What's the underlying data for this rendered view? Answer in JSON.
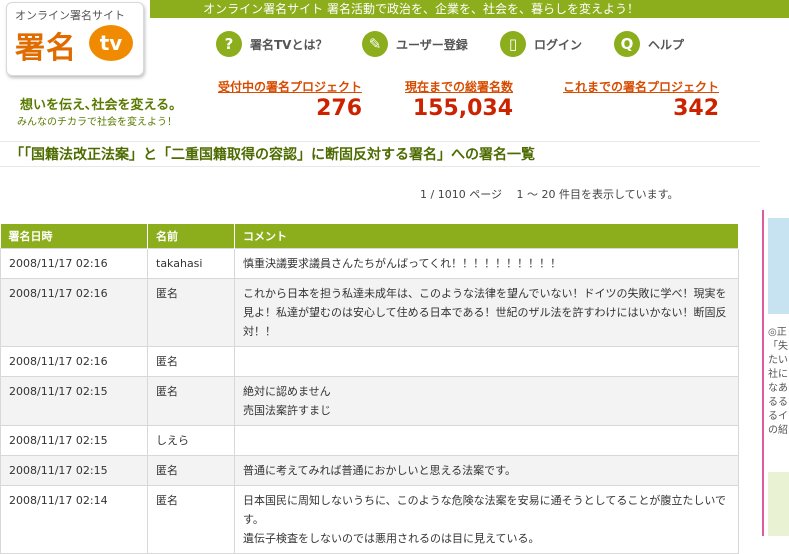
{
  "header": {
    "banner": "オンライン署名サイト 署名活動で政治を、企業を、社会を、暮らしを変えよう！",
    "logo_sub": "オンライン署名サイト",
    "logo_main": "署名",
    "logo_tv": "tv"
  },
  "nav": [
    {
      "icon": "question-icon",
      "glyph": "?",
      "label": "署名TVとは？"
    },
    {
      "icon": "pencil-icon",
      "glyph": "✎",
      "label": "ユーザー登録"
    },
    {
      "icon": "login-icon",
      "glyph": "▯",
      "label": "ログイン"
    },
    {
      "icon": "qa-icon",
      "glyph": "Q",
      "label": "ヘルプ"
    }
  ],
  "tagline": {
    "line1": "想いを伝え､社会を変える。",
    "line2": "みんなのチカラで社会を変えよう！"
  },
  "stats": [
    {
      "label": "受付中の署名プロジェクト",
      "value": "276"
    },
    {
      "label": "現在までの総署名数",
      "value": "155,034"
    },
    {
      "label": "これまでの署名プロジェクト",
      "value": "342"
    }
  ],
  "page_title": "「「国籍法改正法案」と「二重国籍取得の容認」に断固反対する署名」への署名一覧",
  "pager_text": "1 / 1010 ページ　 1 ～ 20 件目を表示しています。",
  "table": {
    "headers": [
      "署名日時",
      "名前",
      "コメント"
    ],
    "rows": [
      {
        "date": "2008/11/17 02:16",
        "name": "takahasi",
        "comment": "慎重決議要求議員さんたちがんばってくれ！！！！！！！！！！"
      },
      {
        "date": "2008/11/17 02:16",
        "name": "匿名",
        "comment": "これから日本を担う私達未成年は、このような法律を望んでいない！ドイツの失敗に学べ！現実を見よ！私達が望むのは安心して住める日本である！世紀のザル法を許すわけにはいかない！断固反対！！"
      },
      {
        "date": "2008/11/17 02:16",
        "name": "匿名",
        "comment": ""
      },
      {
        "date": "2008/11/17 02:15",
        "name": "匿名",
        "comment": "絶対に認めません\n売国法案許すまじ"
      },
      {
        "date": "2008/11/17 02:15",
        "name": "しえら",
        "comment": ""
      },
      {
        "date": "2008/11/17 02:15",
        "name": "匿名",
        "comment": "普通に考えてみれば普通におかしいと思える法案です。"
      },
      {
        "date": "2008/11/17 02:14",
        "name": "匿名",
        "comment": "日本国民に周知しないうちに、このような危険な法案を安易に通そうとしてることが腹立たしいです。\n遺伝子検査をしないのでは悪用されるのは目に見えている。"
      }
    ]
  },
  "side": {
    "text": "◎正\n「失\nたい\n社に\nなあ\nるる\nるイ\nの紹"
  }
}
